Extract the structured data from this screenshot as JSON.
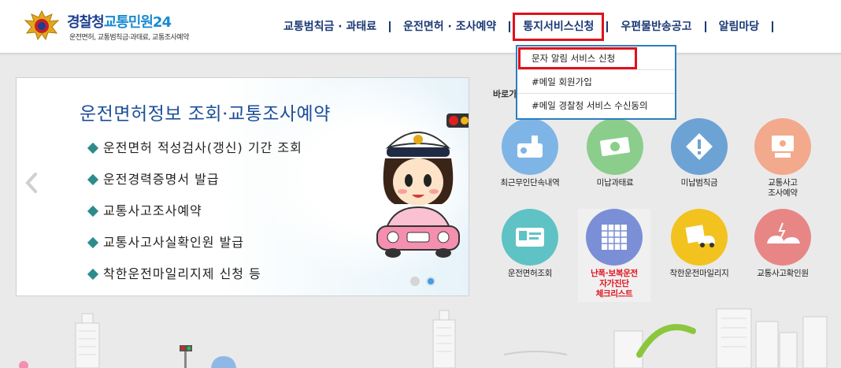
{
  "header": {
    "logo_title_a": "경찰청",
    "logo_title_b": "교통민원24",
    "logo_subtitle": "운전면허, 교통범칙금·과태료, 교통조사예약"
  },
  "gnb": [
    {
      "label": "교통범칙금 · 과태료"
    },
    {
      "label": "운전면허 · 조사예약"
    },
    {
      "label": "통지서비스신청"
    },
    {
      "label": "우편물반송공고"
    },
    {
      "label": "알림마당"
    }
  ],
  "dropdown": [
    {
      "label": "문자 알림 서비스 신청"
    },
    {
      "label": "#메일 회원가입"
    },
    {
      "label": "#메일 경찰청 서비스 수신동의"
    }
  ],
  "banner": {
    "title": "운전면허정보 조회·교통조사예약",
    "items": [
      "운전면허 적성검사(갱신) 기간 조회",
      "운전경력증명서 발급",
      "교통사고조사예약",
      "교통사고사실확인원 발급",
      "착한운전마일리지제 신청 등"
    ],
    "active_slide": 2,
    "slide_count": 2
  },
  "quick": {
    "label": "바로가",
    "items": [
      {
        "label": "최근무인단속내역",
        "color": "#7fb5e6",
        "icon": "camera-icon"
      },
      {
        "label": "미납과태료",
        "color": "#8bcd8b",
        "icon": "money-icon"
      },
      {
        "label": "미납범칙금",
        "color": "#6da2d4",
        "icon": "warning-icon"
      },
      {
        "label": "교통사고\n조사예약",
        "color": "#f3a98c",
        "icon": "computer-icon"
      },
      {
        "label": "운전면허조회",
        "color": "#5fc2c4",
        "icon": "license-card-icon"
      },
      {
        "label": "난폭·보복운전\n자가진단\n체크리스트",
        "color": "#7b8fd6",
        "icon": "checklist-icon"
      },
      {
        "label": "착한운전마일리지",
        "color": "#f2c21e",
        "icon": "mileage-icon"
      },
      {
        "label": "교통사고확인원",
        "color": "#e88686",
        "icon": "accident-icon"
      }
    ]
  }
}
